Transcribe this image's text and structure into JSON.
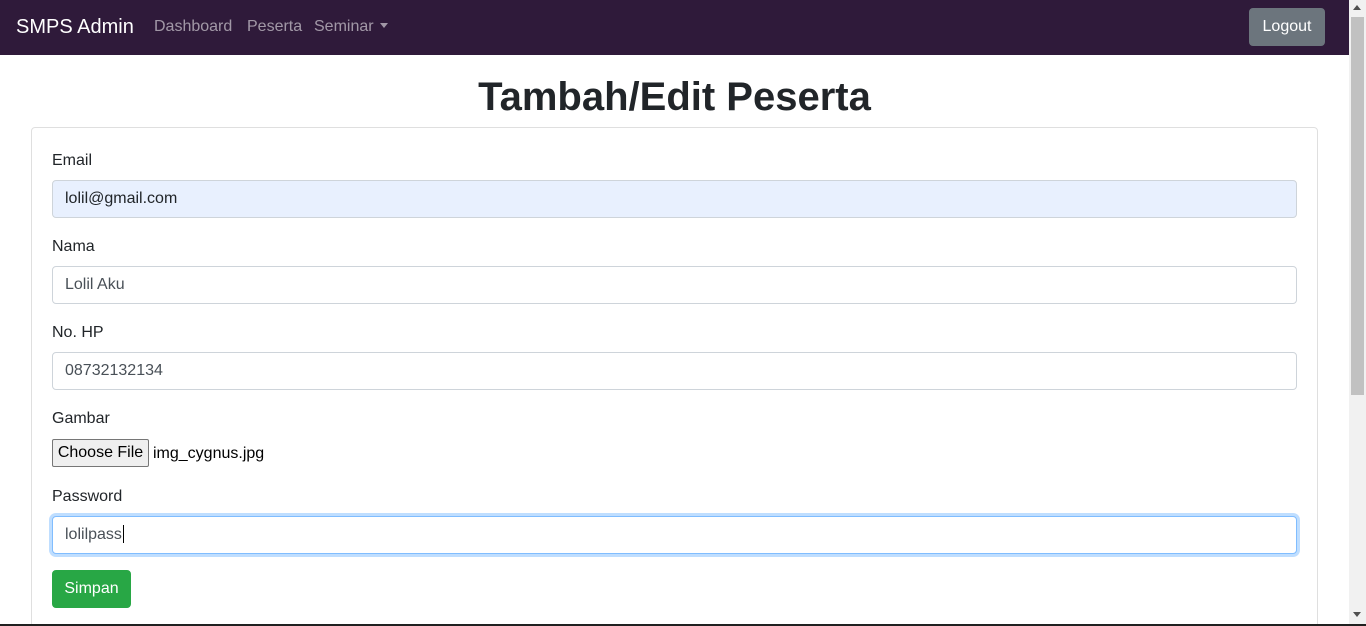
{
  "navbar": {
    "brand": "SMPS Admin",
    "links": [
      {
        "label": "Dashboard"
      },
      {
        "label": "Peserta"
      },
      {
        "label": "Seminar"
      }
    ],
    "logout_label": "Logout"
  },
  "page": {
    "title": "Tambah/Edit Peserta"
  },
  "form": {
    "email": {
      "label": "Email",
      "value": "lolil@gmail.com"
    },
    "nama": {
      "label": "Nama",
      "value": "Lolil Aku"
    },
    "hp": {
      "label": "No. HP",
      "value": "08732132134"
    },
    "gambar": {
      "label": "Gambar",
      "button_label": "Choose File",
      "file_name": "img_cygnus.jpg"
    },
    "password": {
      "label": "Password",
      "value": "lolilpass"
    },
    "submit_label": "Simpan"
  },
  "colors": {
    "navbar_bg": "#2f1a3a",
    "logout_bg": "#6c757d",
    "submit_bg": "#28a745",
    "autofill_bg": "#e8f0fe",
    "focus_border": "#80bdff"
  },
  "icons": {
    "dropdown": "caret-down-icon",
    "scroll_up": "scroll-up-arrow-icon",
    "scroll_down": "scroll-down-arrow-icon"
  }
}
